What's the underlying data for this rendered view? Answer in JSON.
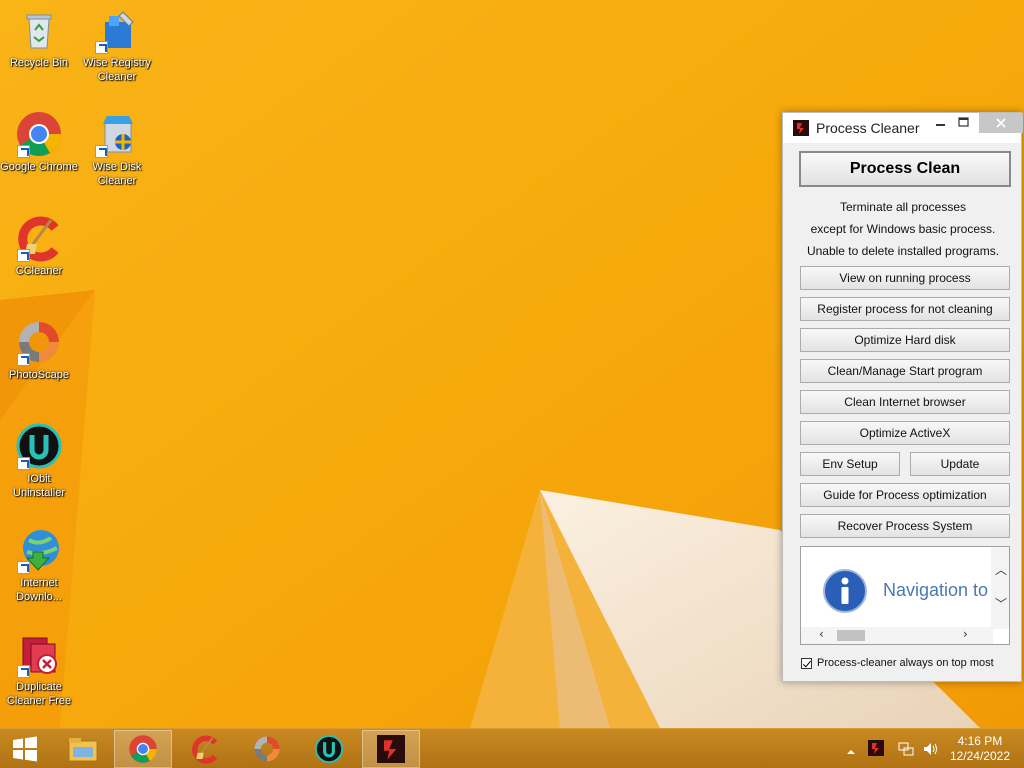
{
  "desktop": {
    "icons": [
      {
        "label": "Recycle Bin"
      },
      {
        "label": "Wise Registry Cleaner"
      },
      {
        "label": "Google Chrome"
      },
      {
        "label": "Wise Disk Cleaner"
      },
      {
        "label": "CCleaner"
      },
      {
        "label": "PhotoScape"
      },
      {
        "label": "IObit Uninstaller"
      },
      {
        "label": "Internet Downlo..."
      },
      {
        "label": "Duplicate Cleaner Free"
      }
    ]
  },
  "window": {
    "title": "Process Cleaner",
    "main_button": "Process Clean",
    "description": [
      "Terminate all processes",
      "except for Windows basic process.",
      "Unable to delete installed programs."
    ],
    "buttons": {
      "view_running": "View on running process",
      "register_not_cleaning": "Register process for not cleaning",
      "optimize_hard_disk": "Optimize Hard disk",
      "clean_start_program": "Clean/Manage Start program",
      "clean_internet_browser": "Clean Internet browser",
      "optimize_activex": "Optimize ActiveX",
      "env_setup": "Env Setup",
      "update": "Update",
      "guide": "Guide for Process optimization",
      "recover": "Recover Process System"
    },
    "nav_text": "Navigation to",
    "always_on_top": {
      "label": "Process-cleaner always on top most",
      "checked": true
    }
  },
  "taskbar": {
    "clock_time": "4:16 PM",
    "clock_date": "12/24/2022"
  },
  "colors": {
    "wallpaper": "#f7a90c",
    "taskbar": "#c0801c",
    "accent_blue": "#1e62c8"
  }
}
